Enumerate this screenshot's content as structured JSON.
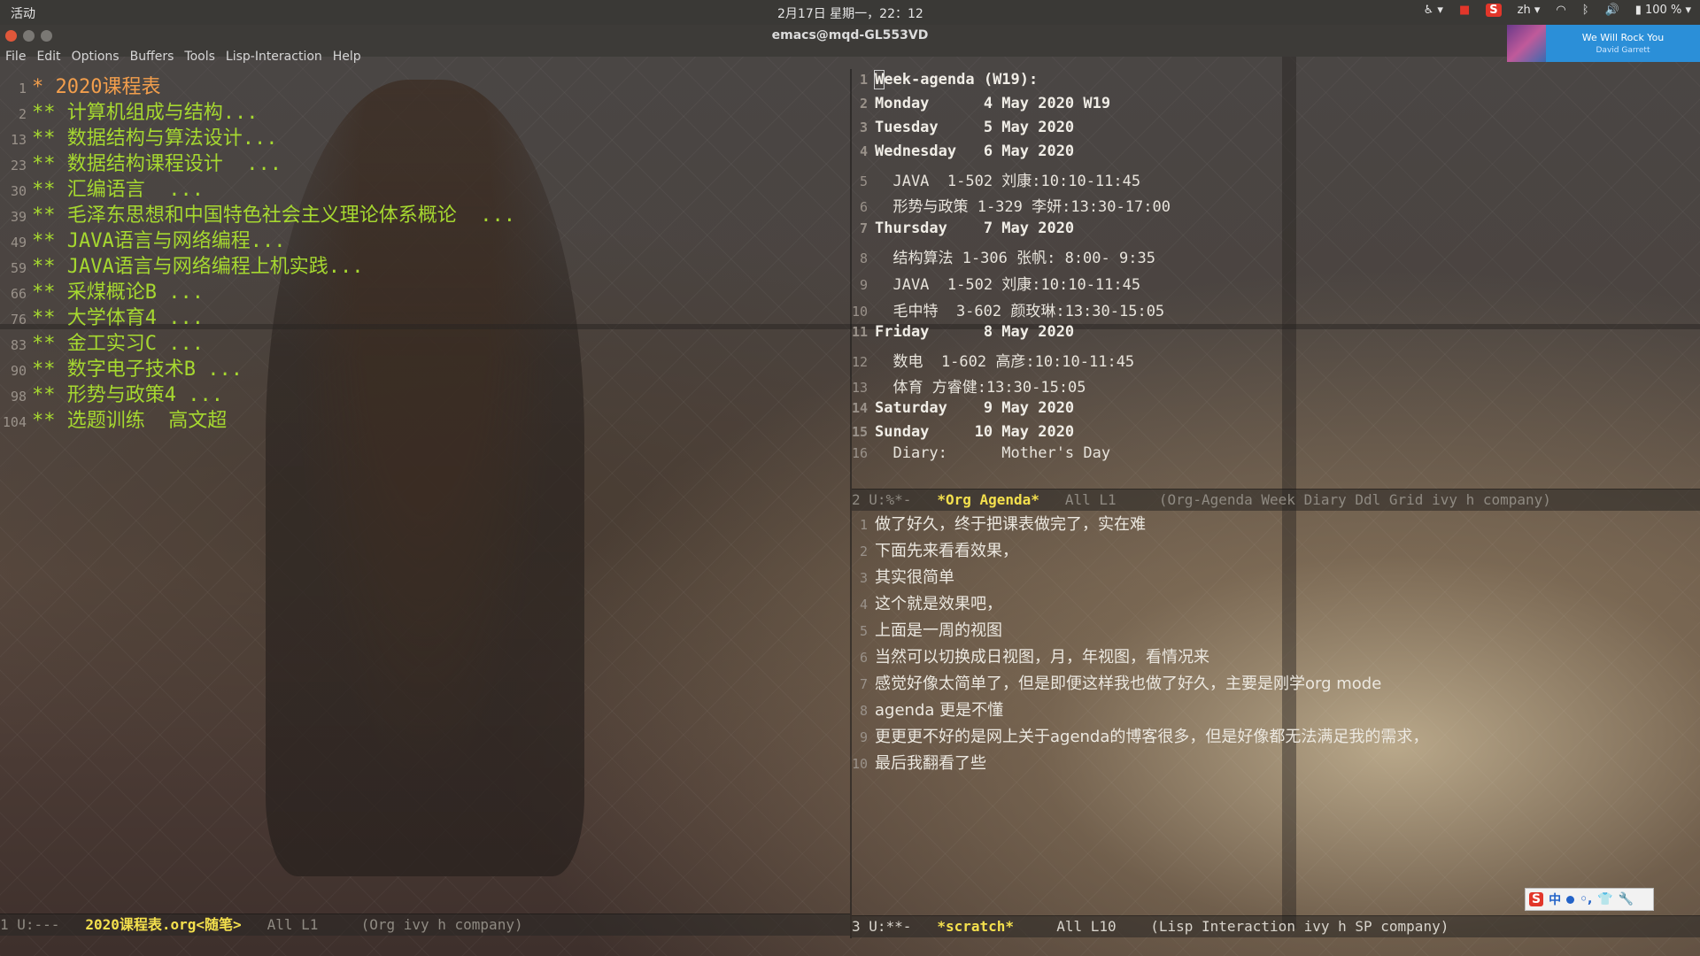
{
  "topbar": {
    "activities": "活动",
    "clock": "2月17日 星期一，22：12",
    "lang": "zh",
    "battery": "100 %"
  },
  "window": {
    "title": "emacs@mqd-GL553VD"
  },
  "menu": [
    "File",
    "Edit",
    "Options",
    "Buffers",
    "Tools",
    "Lisp-Interaction",
    "Help"
  ],
  "music": {
    "song": "We Will Rock You",
    "artist": "David Garrett"
  },
  "left_pane": {
    "lines": [
      {
        "num": "1",
        "text": "* 2020课程表"
      },
      {
        "num": "2",
        "text": "** 计算机组成与结构..."
      },
      {
        "num": "13",
        "text": "** 数据结构与算法设计..."
      },
      {
        "num": "23",
        "text": "** 数据结构课程设计  ..."
      },
      {
        "num": "30",
        "text": "** 汇编语言  ..."
      },
      {
        "num": "39",
        "text": "** 毛泽东思想和中国特色社会主义理论体系概论  ..."
      },
      {
        "num": "49",
        "text": "** JAVA语言与网络编程..."
      },
      {
        "num": "59",
        "text": "** JAVA语言与网络编程上机实践..."
      },
      {
        "num": "66",
        "text": "** 采煤概论B ..."
      },
      {
        "num": "76",
        "text": "** 大学体育4 ..."
      },
      {
        "num": "83",
        "text": "** 金工实习C ..."
      },
      {
        "num": "90",
        "text": "** 数字电子技术B ..."
      },
      {
        "num": "98",
        "text": "** 形势与政策4 ..."
      },
      {
        "num": "104",
        "text": "** 选题训练  高文超"
      }
    ],
    "modeline": {
      "status": "1 U:---",
      "buffer": "2020课程表.org<随笔>",
      "position": "All L1",
      "modes": "(Org ivy h company)"
    }
  },
  "agenda_pane": {
    "lines": [
      {
        "num": "1",
        "text": "Week-agenda (W19):",
        "style": "day"
      },
      {
        "num": "2",
        "text": "Monday      4 May 2020 W19",
        "style": "day"
      },
      {
        "num": "3",
        "text": "Tuesday     5 May 2020",
        "style": "day"
      },
      {
        "num": "4",
        "text": "Wednesday   6 May 2020",
        "style": "day"
      },
      {
        "num": "5",
        "text": "  JAVA  1-502 刘康:10:10-11:45",
        "style": "item"
      },
      {
        "num": "6",
        "text": "  形势与政策 1-329 李妍:13:30-17:00",
        "style": "item"
      },
      {
        "num": "7",
        "text": "Thursday    7 May 2020",
        "style": "day"
      },
      {
        "num": "8",
        "text": "  结构算法 1-306 张帆: 8:00- 9:35",
        "style": "item"
      },
      {
        "num": "9",
        "text": "  JAVA  1-502 刘康:10:10-11:45",
        "style": "item"
      },
      {
        "num": "10",
        "text": "  毛中特  3-602 颜玫琳:13:30-15:05",
        "style": "item"
      },
      {
        "num": "11",
        "text": "Friday      8 May 2020",
        "style": "day"
      },
      {
        "num": "12",
        "text": "  数电  1-602 高彦:10:10-11:45",
        "style": "item"
      },
      {
        "num": "13",
        "text": "  体育 方睿健:13:30-15:05",
        "style": "item"
      },
      {
        "num": "14",
        "text": "Saturday    9 May 2020",
        "style": "day"
      },
      {
        "num": "15",
        "text": "Sunday     10 May 2020",
        "style": "day"
      },
      {
        "num": "16",
        "text": "  Diary:      Mother's Day",
        "style": "item"
      }
    ],
    "modeline": {
      "status": "2 U:%*-",
      "buffer": "*Org Agenda*",
      "position": "All L1",
      "modes": "(Org-Agenda Week Diary Ddl Grid ivy h company)"
    }
  },
  "scratch_pane": {
    "lines": [
      {
        "num": "1",
        "text": "做了好久，终于把课表做完了，实在难"
      },
      {
        "num": "2",
        "text": "下面先来看看效果，"
      },
      {
        "num": "3",
        "text": "其实很简单"
      },
      {
        "num": "4",
        "text": "这个就是效果吧，"
      },
      {
        "num": "5",
        "text": "上面是一周的视图"
      },
      {
        "num": "6",
        "text": "当然可以切换成日视图，月，年视图，看情况来"
      },
      {
        "num": "7",
        "text": "感觉好像太简单了，但是即便这样我也做了好久，主要是刚学org mode"
      },
      {
        "num": "8",
        "text": "agenda 更是不懂"
      },
      {
        "num": "9",
        "text": "更更更不好的是网上关于agenda的博客很多，但是好像都无法满足我的需求，"
      },
      {
        "num": "10",
        "text": "最后我翻看了些"
      }
    ],
    "modeline": {
      "status": "3 U:**-",
      "buffer": "*scratch*",
      "position": "All L10",
      "modes": "(Lisp Interaction ivy h SP company)"
    }
  },
  "ime": {
    "logo": "S",
    "mode": "中"
  }
}
